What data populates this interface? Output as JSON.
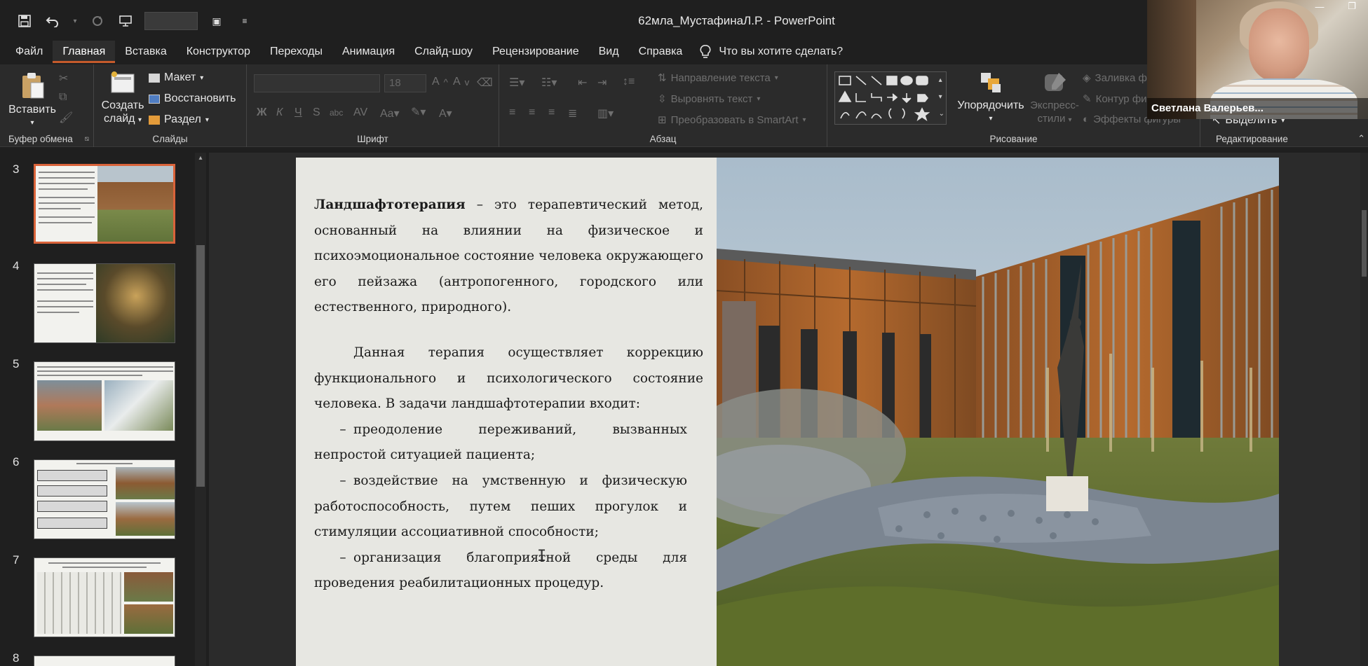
{
  "window": {
    "title": "62мла_МустафинаЛ.Р.  -  PowerPoint"
  },
  "qat": {
    "save_icon": "save-icon",
    "undo_icon": "undo-icon",
    "redo_icon": "redo-icon",
    "present_icon": "present-icon"
  },
  "tabs": [
    {
      "label": "Файл",
      "active": false
    },
    {
      "label": "Главная",
      "active": true
    },
    {
      "label": "Вставка",
      "active": false
    },
    {
      "label": "Конструктор",
      "active": false
    },
    {
      "label": "Переходы",
      "active": false
    },
    {
      "label": "Анимация",
      "active": false
    },
    {
      "label": "Слайд-шоу",
      "active": false
    },
    {
      "label": "Рецензирование",
      "active": false
    },
    {
      "label": "Вид",
      "active": false
    },
    {
      "label": "Справка",
      "active": false
    }
  ],
  "tell_me": "Что вы хотите сделать?",
  "ribbon": {
    "clipboard": {
      "paste": "Вставить",
      "label": "Буфер обмена"
    },
    "slides": {
      "new_slide_1": "Создать",
      "new_slide_2": "слайд",
      "layout": "Макет",
      "reset": "Восстановить",
      "section": "Раздел",
      "label": "Слайды"
    },
    "font": {
      "size": "18",
      "label": "Шрифт"
    },
    "paragraph": {
      "text_direction": "Направление текста",
      "align_text": "Выровнять текст",
      "smartart": "Преобразовать в SmartArt",
      "label": "Абзац"
    },
    "drawing": {
      "arrange": "Упорядочить",
      "quick_styles_1": "Экспресс-",
      "quick_styles_2": "стили",
      "shape_fill": "Заливка фигуры",
      "shape_outline": "Контур фигуры",
      "shape_effects": "Эффекты фигуры",
      "label": "Рисование"
    },
    "editing": {
      "select": "Выделить",
      "label": "Редактирование"
    }
  },
  "webcam": {
    "name": "Светлана Валерьев..."
  },
  "thumbnails": [
    {
      "number": "3",
      "selected": true
    },
    {
      "number": "4",
      "selected": false
    },
    {
      "number": "5",
      "selected": false
    },
    {
      "number": "6",
      "selected": false
    },
    {
      "number": "7",
      "selected": false
    },
    {
      "number": "8",
      "selected": false
    }
  ],
  "slide": {
    "term": "Ландшафтотерапия",
    "definition": " – это терапевтический метод, основанный на влиянии  на физическое и психоэмоциональное состояние человека окружающего его  пейзажа (антропогенного, городского или естественного, природного).",
    "para2": "Данная терапия осуществляет коррекцию функционального и психологического состояние человека. В задачи ландшафтотерапии входит:",
    "items": [
      "преодоление переживаний, вызванных непростой ситуацией пациента;",
      "воздействие на умственную и физическую работоспособность, путем пеших прогулок и стимуляции ассоциативной способности;",
      "организация благоприятной среды для проведения реабилитационных процедур."
    ]
  }
}
